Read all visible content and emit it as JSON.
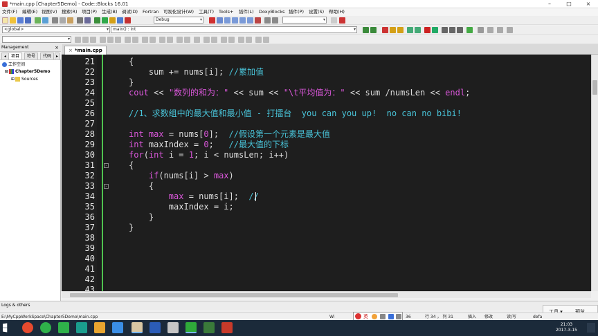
{
  "window": {
    "title": "*main.cpp [Chapter5Demo] - Code::Blocks 16.01",
    "minimize": "–",
    "maximize": "□",
    "close": "×"
  },
  "menu": [
    "文件(F)",
    "编辑(E)",
    "视图(V)",
    "搜索(R)",
    "项目(P)",
    "生成(B)",
    "调试(D)",
    "Fortran",
    "可视化设计(W)",
    "工具(T)",
    "Tools+",
    "插件(L)",
    "DoxyBlocks",
    "插件(P)",
    "设置(S)",
    "帮助(H)"
  ],
  "toolbar": {
    "build_target": "Debug",
    "scope": "<global>",
    "function": "main() : int"
  },
  "management": {
    "header": "Management",
    "close": "×",
    "tabs": [
      "项目",
      "符号",
      "代码"
    ],
    "tree": {
      "workspace": "工作空间",
      "project": "Chapter5Demo",
      "sources": "Sources"
    }
  },
  "editor": {
    "tab_label": "*main.cpp",
    "tab_close": "×",
    "line_numbers": [
      "21",
      "22",
      "23",
      "24",
      "25",
      "26",
      "27",
      "28",
      "29",
      "30",
      "31",
      "32",
      "33",
      "34",
      "35",
      "36",
      "37",
      "38",
      "39",
      "40",
      "41",
      "42",
      "43"
    ]
  },
  "logs_tab": "Logs & others",
  "status": {
    "path": "E:\\MyCppWorkSpace\\Chapter5Demo\\main.cpp",
    "encoding": "Wi",
    "position": "行 34 ， 列 31",
    "col_num": "36",
    "mode_insert": "插入",
    "mode_modified": "修改",
    "mode_rw": "读/写",
    "default": "defa"
  },
  "ime": {
    "label": "英"
  },
  "tools_popup": {
    "tools": "工具 ▾",
    "preview": "预览"
  },
  "taskbar": {
    "time": "21:03",
    "date": "2017-3-15"
  }
}
